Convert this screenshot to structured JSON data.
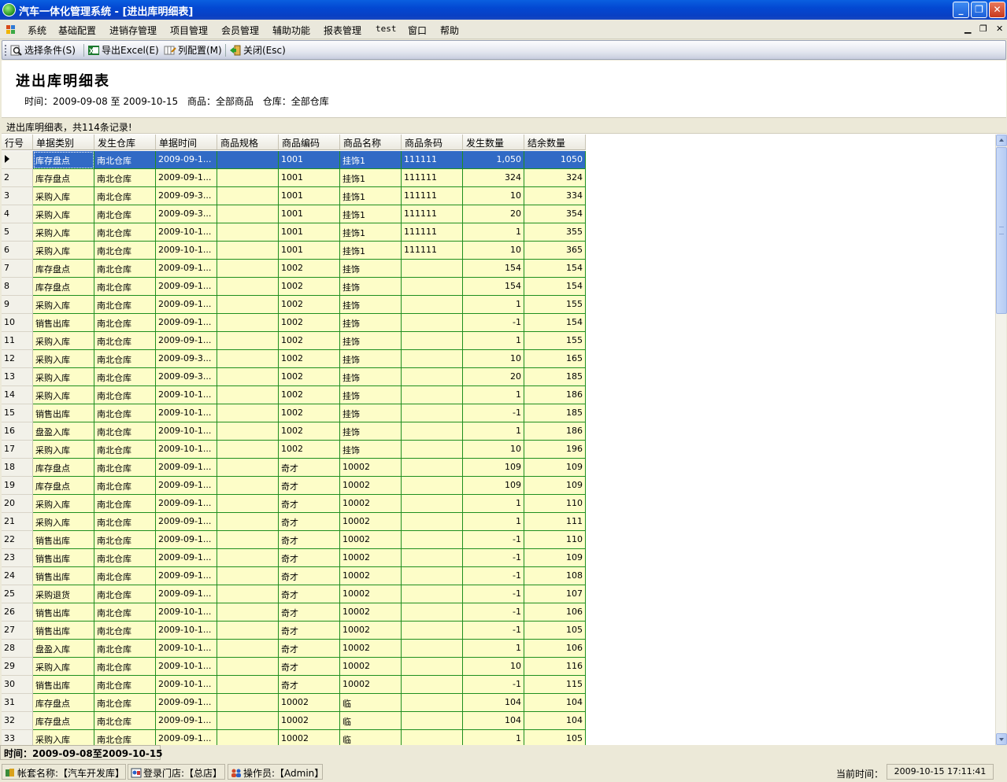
{
  "window": {
    "title": "汽车一体化管理系统 - [进出库明细表]",
    "icon": "app-globe-icon"
  },
  "menu": {
    "items": [
      "系统",
      "基础配置",
      "进销存管理",
      "项目管理",
      "会员管理",
      "辅助功能",
      "报表管理",
      "test",
      "窗口",
      "帮助"
    ],
    "mdi_controls": [
      "▁",
      "❐",
      "✕"
    ]
  },
  "toolbar": {
    "select_conditions": "选择条件(S)",
    "export_excel": "导出Excel(E)",
    "column_config": "列配置(M)",
    "close": "关闭(Esc)"
  },
  "report": {
    "title": "进出库明细表",
    "time_range": "时间：2009-09-08 至 2009-10-15",
    "product": "商品：全部商品",
    "warehouse": "仓库：全部仓库"
  },
  "grid": {
    "caption": "进出库明细表，共114条记录!",
    "columns": [
      "行号",
      "单据类别",
      "发生仓库",
      "单据时间",
      "商品规格",
      "商品编码",
      "商品名称",
      "商品条码",
      "发生数量",
      "结余数量"
    ],
    "rows": [
      [
        "",
        "库存盘点",
        "南北仓库",
        "2009-09-1...",
        "",
        "1001",
        "挂饰1",
        "111111",
        "1,050",
        "1050"
      ],
      [
        "2",
        "库存盘点",
        "南北仓库",
        "2009-09-1...",
        "",
        "1001",
        "挂饰1",
        "111111",
        "324",
        "324"
      ],
      [
        "3",
        "采购入库",
        "南北仓库",
        "2009-09-3...",
        "",
        "1001",
        "挂饰1",
        "111111",
        "10",
        "334"
      ],
      [
        "4",
        "采购入库",
        "南北仓库",
        "2009-09-3...",
        "",
        "1001",
        "挂饰1",
        "111111",
        "20",
        "354"
      ],
      [
        "5",
        "采购入库",
        "南北仓库",
        "2009-10-1...",
        "",
        "1001",
        "挂饰1",
        "111111",
        "1",
        "355"
      ],
      [
        "6",
        "采购入库",
        "南北仓库",
        "2009-10-1...",
        "",
        "1001",
        "挂饰1",
        "111111",
        "10",
        "365"
      ],
      [
        "7",
        "库存盘点",
        "南北仓库",
        "2009-09-1...",
        "",
        "1002",
        "挂饰",
        "",
        "154",
        "154"
      ],
      [
        "8",
        "库存盘点",
        "南北仓库",
        "2009-09-1...",
        "",
        "1002",
        "挂饰",
        "",
        "154",
        "154"
      ],
      [
        "9",
        "采购入库",
        "南北仓库",
        "2009-09-1...",
        "",
        "1002",
        "挂饰",
        "",
        "1",
        "155"
      ],
      [
        "10",
        "销售出库",
        "南北仓库",
        "2009-09-1...",
        "",
        "1002",
        "挂饰",
        "",
        "-1",
        "154"
      ],
      [
        "11",
        "采购入库",
        "南北仓库",
        "2009-09-1...",
        "",
        "1002",
        "挂饰",
        "",
        "1",
        "155"
      ],
      [
        "12",
        "采购入库",
        "南北仓库",
        "2009-09-3...",
        "",
        "1002",
        "挂饰",
        "",
        "10",
        "165"
      ],
      [
        "13",
        "采购入库",
        "南北仓库",
        "2009-09-3...",
        "",
        "1002",
        "挂饰",
        "",
        "20",
        "185"
      ],
      [
        "14",
        "采购入库",
        "南北仓库",
        "2009-10-1...",
        "",
        "1002",
        "挂饰",
        "",
        "1",
        "186"
      ],
      [
        "15",
        "销售出库",
        "南北仓库",
        "2009-10-1...",
        "",
        "1002",
        "挂饰",
        "",
        "-1",
        "185"
      ],
      [
        "16",
        "盘盈入库",
        "南北仓库",
        "2009-10-1...",
        "",
        "1002",
        "挂饰",
        "",
        "1",
        "186"
      ],
      [
        "17",
        "采购入库",
        "南北仓库",
        "2009-10-1...",
        "",
        "1002",
        "挂饰",
        "",
        "10",
        "196"
      ],
      [
        "18",
        "库存盘点",
        "南北仓库",
        "2009-09-1...",
        "",
        "奇才",
        "10002",
        "",
        "109",
        "109"
      ],
      [
        "19",
        "库存盘点",
        "南北仓库",
        "2009-09-1...",
        "",
        "奇才",
        "10002",
        "",
        "109",
        "109"
      ],
      [
        "20",
        "采购入库",
        "南北仓库",
        "2009-09-1...",
        "",
        "奇才",
        "10002",
        "",
        "1",
        "110"
      ],
      [
        "21",
        "采购入库",
        "南北仓库",
        "2009-09-1...",
        "",
        "奇才",
        "10002",
        "",
        "1",
        "111"
      ],
      [
        "22",
        "销售出库",
        "南北仓库",
        "2009-09-1...",
        "",
        "奇才",
        "10002",
        "",
        "-1",
        "110"
      ],
      [
        "23",
        "销售出库",
        "南北仓库",
        "2009-09-1...",
        "",
        "奇才",
        "10002",
        "",
        "-1",
        "109"
      ],
      [
        "24",
        "销售出库",
        "南北仓库",
        "2009-09-1...",
        "",
        "奇才",
        "10002",
        "",
        "-1",
        "108"
      ],
      [
        "25",
        "采购退货",
        "南北仓库",
        "2009-09-1...",
        "",
        "奇才",
        "10002",
        "",
        "-1",
        "107"
      ],
      [
        "26",
        "销售出库",
        "南北仓库",
        "2009-10-1...",
        "",
        "奇才",
        "10002",
        "",
        "-1",
        "106"
      ],
      [
        "27",
        "销售出库",
        "南北仓库",
        "2009-10-1...",
        "",
        "奇才",
        "10002",
        "",
        "-1",
        "105"
      ],
      [
        "28",
        "盘盈入库",
        "南北仓库",
        "2009-10-1...",
        "",
        "奇才",
        "10002",
        "",
        "1",
        "106"
      ],
      [
        "29",
        "采购入库",
        "南北仓库",
        "2009-10-1...",
        "",
        "奇才",
        "10002",
        "",
        "10",
        "116"
      ],
      [
        "30",
        "销售出库",
        "南北仓库",
        "2009-10-1...",
        "",
        "奇才",
        "10002",
        "",
        "-1",
        "115"
      ],
      [
        "31",
        "库存盘点",
        "南北仓库",
        "2009-09-1...",
        "",
        "10002",
        "临",
        "",
        "104",
        "104"
      ],
      [
        "32",
        "库存盘点",
        "南北仓库",
        "2009-09-1...",
        "",
        "10002",
        "临",
        "",
        "104",
        "104"
      ],
      [
        "33",
        "采购入库",
        "南北仓库",
        "2009-09-1...",
        "",
        "10002",
        "临",
        "",
        "1",
        "105"
      ]
    ]
  },
  "time_bar": "时间：2009-09-08至2009-10-15",
  "status": {
    "account": "帐套名称:【汽车开发库】",
    "store": "登录门店:【总店】",
    "operator": "操作员:【Admin】",
    "current_time_label": "当前时间：",
    "current_time": "2009-10-15 17:11:41"
  },
  "colors": {
    "row_bg": "#fdfdc8",
    "grid_line": "#1f8f1f",
    "selected": "#316ac5"
  }
}
